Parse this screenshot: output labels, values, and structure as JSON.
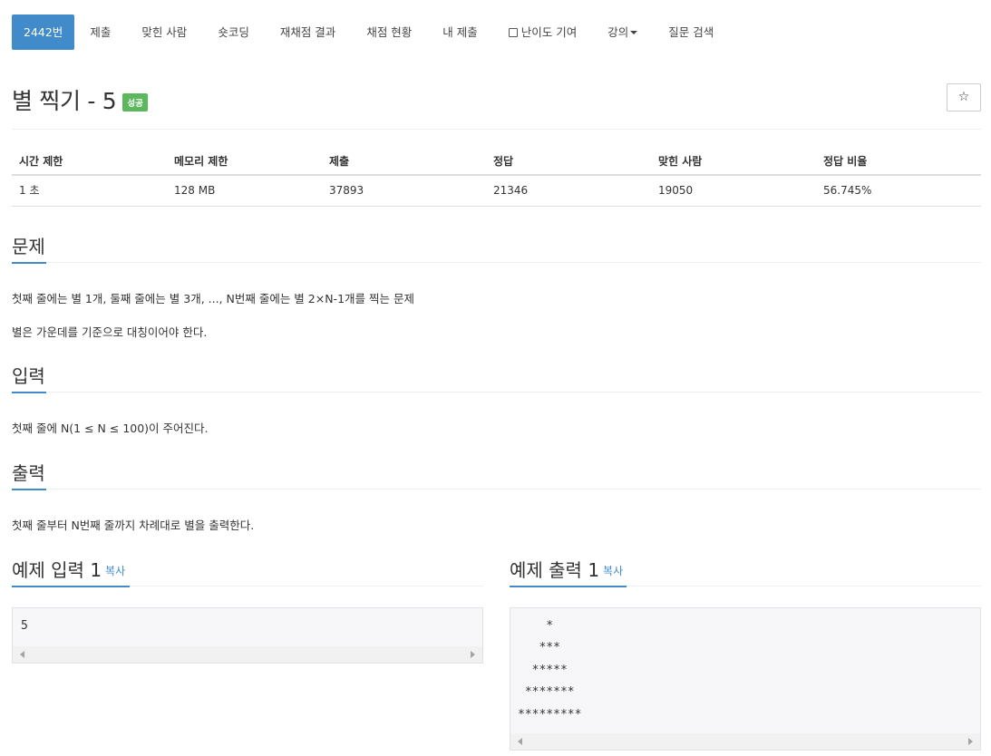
{
  "nav": {
    "tabs": [
      "2442번",
      "제출",
      "맞힌 사람",
      "숏코딩",
      "재채점 결과",
      "채점 현황",
      "내 제출",
      "난이도 기여",
      "강의",
      "질문 검색"
    ]
  },
  "problem": {
    "title": "별 찍기 - 5",
    "badge": "성공",
    "star": "☆"
  },
  "info": {
    "headers": [
      "시간 제한",
      "메모리 제한",
      "제출",
      "정답",
      "맞힌 사람",
      "정답 비율"
    ],
    "values": [
      "1 초",
      "128 MB",
      "37893",
      "21346",
      "19050",
      "56.745%"
    ]
  },
  "sections": {
    "problem_h": "문제",
    "problem_p1": "첫째 줄에는 별 1개, 둘째 줄에는 별 3개, ..., N번째 줄에는 별 2×N-1개를 찍는 문제",
    "problem_p2": "별은 가운데를 기준으로 대칭이어야 한다.",
    "input_h": "입력",
    "input_p": "첫째 줄에 N(1 ≤ N ≤ 100)이 주어진다.",
    "output_h": "출력",
    "output_p": "첫째 줄부터 N번째 줄까지 차례대로 별을 출력한다."
  },
  "samples": {
    "input_h": "예제 입력 1",
    "output_h": "예제 출력 1",
    "copy": "복사",
    "input_text": "5",
    "output_text": "    *\n   ***\n  *****\n *******\n*********"
  },
  "colors": {
    "accent": "#428bca",
    "success": "#5cb85c"
  }
}
